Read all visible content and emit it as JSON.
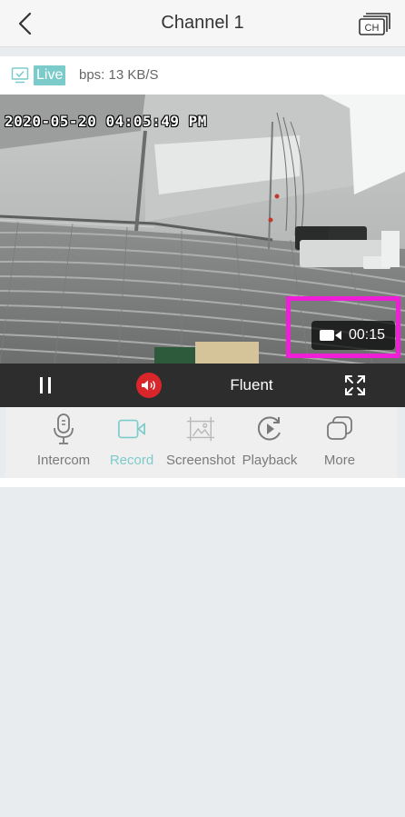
{
  "header": {
    "back_icon": "chevron-left-icon",
    "title": "Channel 1",
    "channel_button_label": "CH"
  },
  "status": {
    "live_label": "Live",
    "bps_text": "bps: 13 KB/S"
  },
  "video": {
    "timestamp": "2020-05-20 04:05:49 PM",
    "recording_time": "00:15",
    "highlight_color": "#ee1fd7"
  },
  "controls": {
    "pause_icon": "pause-icon",
    "audio_icon": "speaker-icon",
    "audio_color": "#d8262b",
    "quality_label": "Fluent",
    "fullscreen_icon": "fullscreen-icon"
  },
  "tools": [
    {
      "label": "Intercom",
      "icon": "microphone-icon",
      "active": false
    },
    {
      "label": "Record",
      "icon": "video-camera-icon",
      "active": true
    },
    {
      "label": "Screenshot",
      "icon": "image-icon",
      "active": false
    },
    {
      "label": "Playback",
      "icon": "playback-icon",
      "active": false
    },
    {
      "label": "More",
      "icon": "more-icon",
      "active": false
    }
  ],
  "colors": {
    "accent": "#7ecbcb",
    "control_bar": "#2d2d2d"
  }
}
